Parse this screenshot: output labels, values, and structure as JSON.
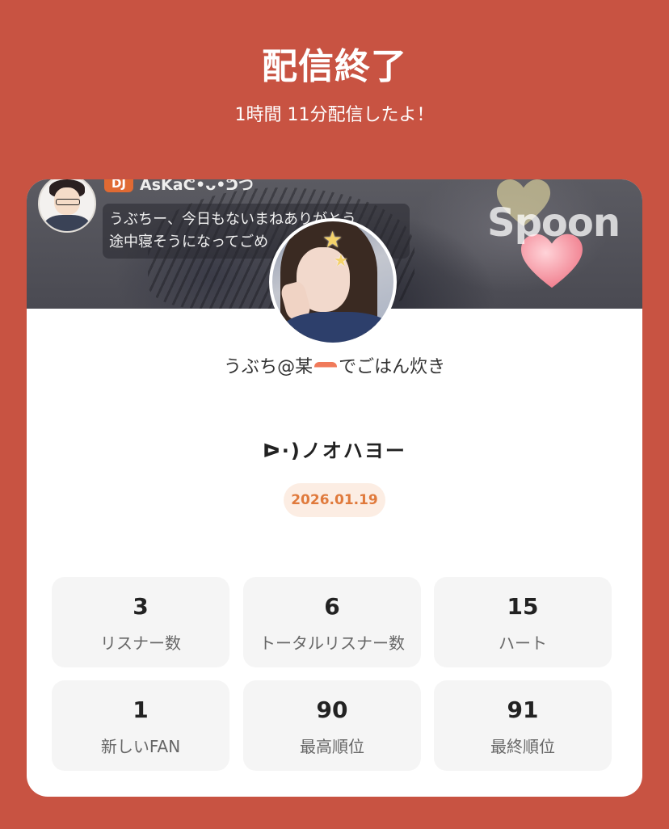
{
  "header": {
    "title": "配信終了",
    "subtitle": "1時間 11分配信したよ！"
  },
  "banner": {
    "dj_badge": "DJ",
    "dj_name": "AsKaᕦ•ᴗ•ᕤつ",
    "comment_line1": "うぶちー、今日もないまねありがとう",
    "comment_line2": "途中寝そうになってごめ",
    "brand": "Spoon"
  },
  "profile": {
    "nickname_before": "うぶち@某",
    "nickname_after": "でごはん炊き"
  },
  "broadcast": {
    "logo_text": "ᐅ·)ノオハヨー",
    "date": "2026.01.19"
  },
  "stats": [
    {
      "value": "3",
      "label": "リスナー数"
    },
    {
      "value": "6",
      "label": "トータルリスナー数"
    },
    {
      "value": "15",
      "label": "ハート"
    },
    {
      "value": "1",
      "label": "新しいFAN"
    },
    {
      "value": "90",
      "label": "最高順位"
    },
    {
      "value": "91",
      "label": "最終順位"
    }
  ],
  "colors": {
    "background": "#C85342",
    "accent": "#E07A3C",
    "date_pill_bg": "#FCEDE3",
    "stat_bg": "#F5F5F5"
  },
  "icons": [
    "heart-icon",
    "star-icon",
    "sushi-emoji-icon",
    "play-icon"
  ]
}
